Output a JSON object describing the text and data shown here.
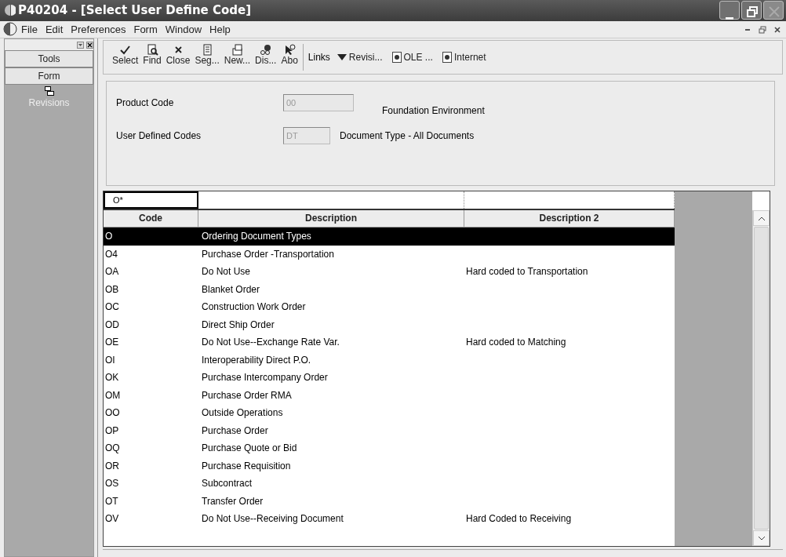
{
  "window": {
    "title": "P40204 - [Select User Define Code]"
  },
  "menu": [
    "File",
    "Edit",
    "Preferences",
    "Form",
    "Window",
    "Help"
  ],
  "sidebar": {
    "buttons": [
      "Tools",
      "Form"
    ],
    "items": [
      {
        "label": "Revisions"
      }
    ]
  },
  "toolbar": {
    "buttons": [
      "Select",
      "Find",
      "Close",
      "Seg...",
      "New...",
      "Dis...",
      "Abo"
    ],
    "links_label": "Links",
    "links": [
      {
        "kind": "dropdown",
        "label": "Revisi..."
      },
      {
        "kind": "document",
        "label": "OLE ..."
      },
      {
        "kind": "document",
        "label": "Internet"
      }
    ]
  },
  "form": {
    "fields": [
      {
        "label": "Product Code",
        "value": "00",
        "description": "Foundation Environment"
      },
      {
        "label": "User Defined Codes",
        "value": "DT",
        "description": "Document Type - All Documents"
      }
    ]
  },
  "grid": {
    "filter": [
      "O*"
    ],
    "columns": [
      "Code",
      "Description",
      "Description 2"
    ],
    "rows": [
      {
        "code": "O",
        "description": "Ordering Document Types",
        "selected": true
      },
      {
        "code": "O4",
        "description": "Purchase Order -Transportation",
        "selected": false
      },
      {
        "code": "OA",
        "description": "Do Not Use",
        "description_2": "Hard coded to Transportation",
        "selected": false
      },
      {
        "code": "OB",
        "description": "Blanket Order",
        "selected": false
      },
      {
        "code": "OC",
        "description": "Construction Work Order",
        "selected": false
      },
      {
        "code": "OD",
        "description": "Direct Ship Order",
        "selected": false
      },
      {
        "code": "OE",
        "description": "Do Not Use--Exchange Rate Var.",
        "description_2": "Hard coded to Matching",
        "selected": false
      },
      {
        "code": "OI",
        "description": "Interoperability Direct P.O.",
        "selected": false
      },
      {
        "code": "OK",
        "description": "Purchase Intercompany Order",
        "selected": false
      },
      {
        "code": "OM",
        "description": "Purchase Order RMA",
        "selected": false
      },
      {
        "code": "OO",
        "description": "Outside Operations",
        "selected": false
      },
      {
        "code": "OP",
        "description": "Purchase Order",
        "selected": false
      },
      {
        "code": "OQ",
        "description": "Purchase Quote or Bid",
        "selected": false
      },
      {
        "code": "OR",
        "description": "Purchase Requisition",
        "selected": false
      },
      {
        "code": "OS",
        "description": "Subcontract",
        "selected": false
      },
      {
        "code": "OT",
        "description": "Transfer Order",
        "selected": false
      },
      {
        "code": "OV",
        "description": "Do Not Use--Receiving Document",
        "description_2": "Hard Coded to Receiving",
        "selected": false
      }
    ]
  }
}
